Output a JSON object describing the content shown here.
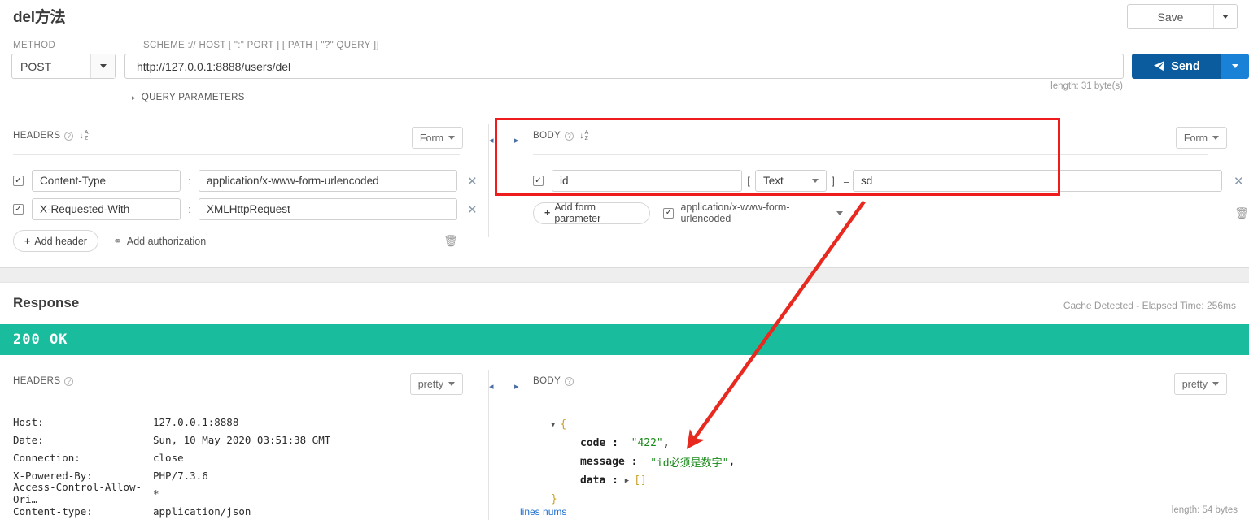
{
  "request": {
    "title": "del方法",
    "save_label": "Save",
    "method_label": "METHOD",
    "method_value": "POST",
    "scheme_label": "SCHEME :// HOST [ \":\" PORT ] [ PATH [ \"?\" QUERY ]]",
    "url_value": "http://127.0.0.1:8888/users/del",
    "send_label": "Send",
    "length_note": "length: 31 byte(s)",
    "query_parameters_label": "QUERY PARAMETERS",
    "headers_panel": {
      "title": "HEADERS",
      "view_mode": "Form",
      "separator": ":",
      "rows": [
        {
          "name": "Content-Type",
          "value": "application/x-www-form-urlencoded"
        },
        {
          "name": "X-Requested-With",
          "value": "XMLHttpRequest"
        }
      ],
      "add_header_label": "Add header",
      "add_authorization_label": "Add authorization"
    },
    "body_panel": {
      "title": "BODY",
      "view_mode": "Form",
      "rows": [
        {
          "name": "id",
          "type": "Text",
          "equals": "=",
          "value": "sd",
          "open_bracket": "[",
          "close_bracket": "]"
        }
      ],
      "add_form_parameter_label": "Add form parameter",
      "content_type": "application/x-www-form-urlencoded"
    }
  },
  "response": {
    "title": "Response",
    "cache_info": "Cache Detected - Elapsed Time: 256ms",
    "status": "200 OK",
    "status_color": "#19bc9c",
    "headers_panel": {
      "title": "HEADERS",
      "view_mode": "pretty",
      "rows": [
        {
          "key": "Host:",
          "value": "127.0.0.1:8888"
        },
        {
          "key": "Date:",
          "value": "Sun, 10 May 2020 03:51:38 GMT"
        },
        {
          "key": "Connection:",
          "value": "close"
        },
        {
          "key": "X-Powered-By:",
          "value": "PHP/7.3.6"
        },
        {
          "key": "Access-Control-Allow-Ori…",
          "value": "*"
        },
        {
          "key": "Content-type:",
          "value": "application/json"
        }
      ]
    },
    "body_panel": {
      "title": "BODY",
      "view_mode": "pretty",
      "json": {
        "open": "{",
        "close": "}",
        "lines": [
          {
            "key": "code",
            "colon": ":",
            "value": "\"422\"",
            "comma": ","
          },
          {
            "key": "message",
            "colon": ":",
            "value": "\"id必须是数字\"",
            "comma": ","
          },
          {
            "key": "data",
            "colon": ":",
            "value": "[]",
            "comma": ""
          }
        ]
      },
      "lines_nums_label": "lines nums",
      "length_note": "length: 54 bytes"
    }
  },
  "annotation": {
    "highlight_color": "#ee1c1c",
    "arrow_color": "#e8291f"
  }
}
